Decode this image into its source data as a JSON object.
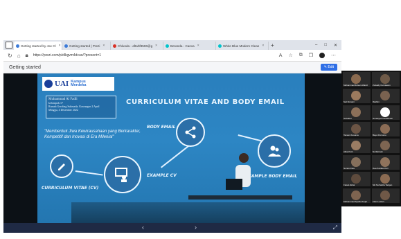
{
  "browser": {
    "tabs": [
      {
        "label": "Getting started by Joe Cl",
        "color": "#3b7bd9",
        "active": true
      },
      {
        "label": "Getting started | Prezi",
        "color": "#3b7bd9",
        "active": false
      },
      {
        "label": "Chlunda - aftahf8506@g",
        "color": "#d93025",
        "active": false
      },
      {
        "label": "Beranda - Canva",
        "color": "#00c4cc",
        "active": false
      },
      {
        "label": "White Blue Modern Clean",
        "color": "#00c4cc",
        "active": false
      }
    ],
    "new_tab": "+",
    "url": "https://prezi.com/p/dlkgvm4dcuo/?present=1",
    "window_controls": {
      "minimize": "–",
      "maximize": "□",
      "close": "✕"
    }
  },
  "prezi": {
    "title": "Getting started",
    "edit_label": "Edit"
  },
  "slide": {
    "logo_uai": "UAI",
    "logo_km_1": "Kampus",
    "logo_km_2": "Merdeka",
    "info_name": "Muhammad Al Fadli",
    "info_group": "kelompok 17",
    "info_address": "Rumah Gerobag Sukmada, Kawangan 2 April",
    "info_date": "Minggu, 4 Desember 2022",
    "title": "CURRICULUM VITAE AND BODY EMAIL",
    "quote": "\"Membentuk Jiwa Kewirausahaan yang Berkarakter, Kompetitif dan Inovasi di Era Milenial\"",
    "label_body_email": "BODY EMAIL",
    "label_example_cv": "EXAMPLE CV",
    "label_example_body": "EXAMPLE BODY EMAIL",
    "label_cv": "CURRICULUM VITAE (CV)"
  },
  "controls": {
    "prev": "‹",
    "next": "›",
    "fullscreen": "⤢"
  },
  "participants": [
    {
      "name": "Muhammad Ikhsan Alfarizi",
      "color": "#8a6a4f"
    },
    {
      "name": "Zubaidy Kurniawan",
      "color": "#6e5a48"
    },
    {
      "name": "Sari Nuraini",
      "color": "#9b7a5e"
    },
    {
      "name": "Ibrahim",
      "color": "#7a6250"
    },
    {
      "name": "Suhaibur",
      "color": "#8c7059"
    },
    {
      "name": "Nuraisyah Nurfatimah",
      "color": "#ffffff"
    },
    {
      "name": "Tamam Kusuma",
      "color": "#6b5444"
    },
    {
      "name": "Bayu Purnomo",
      "color": "#8b6c55"
    },
    {
      "name": "Alika Putri",
      "color": "#9a7c63"
    },
    {
      "name": "Nurfatimah",
      "color": "#7d6552"
    },
    {
      "name": "Nuraini Dea",
      "color": "#86705c"
    },
    {
      "name": "Dea Kartika Putri",
      "color": "#8f735c"
    },
    {
      "name": "Faisal Akbar",
      "color": "#5e4b3d"
    },
    {
      "name": "Siti Nurhaliza Tarigan",
      "color": "#8b6b52"
    },
    {
      "name": "Muhammad Syaiful Amjar",
      "color": "#7e6450"
    },
    {
      "name": "Intan Lestari",
      "color": "#6f5847"
    }
  ]
}
